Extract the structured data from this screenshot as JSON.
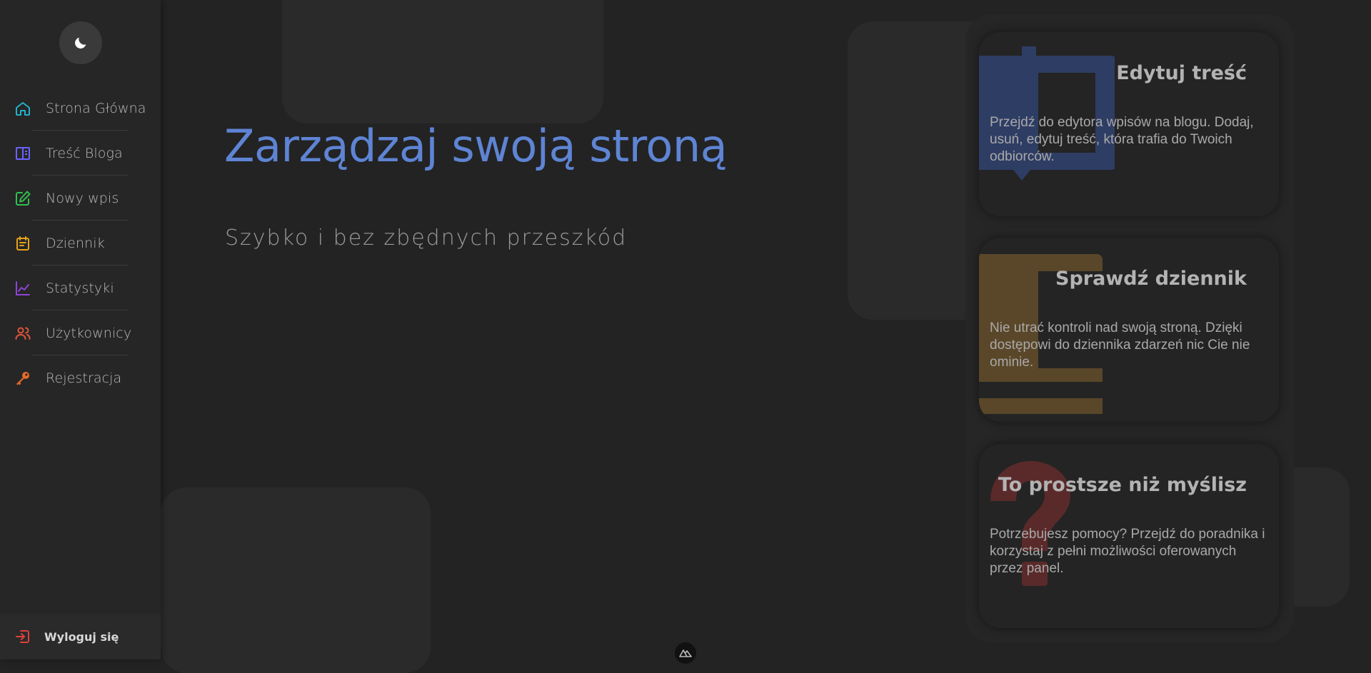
{
  "sidebar": {
    "theme_toggle_icon": "moon-icon",
    "items": [
      {
        "label": "Strona Główna",
        "icon": "home-icon",
        "color": "#22b0c8"
      },
      {
        "label": "Treść Bloga",
        "icon": "book-open-icon",
        "color": "#6c63ff"
      },
      {
        "label": "Nowy wpis",
        "icon": "edit-icon",
        "color": "#2fbf4f"
      },
      {
        "label": "Dziennik",
        "icon": "calendar-icon",
        "color": "#e6a21a"
      },
      {
        "label": "Statystyki",
        "icon": "chart-line-icon",
        "color": "#8e44d8"
      },
      {
        "label": "Użytkownicy",
        "icon": "users-icon",
        "color": "#e0553b"
      },
      {
        "label": "Rejestracja",
        "icon": "key-icon",
        "color": "#e46a2a"
      }
    ],
    "logout": {
      "label": "Wyloguj się",
      "icon": "logout-icon",
      "color": "#e0403b"
    }
  },
  "hero": {
    "title": "Zarządzaj swoją stroną",
    "subtitle": "Szybko i bez zbędnych przeszkód",
    "title_color": "#5e84d4"
  },
  "cards": [
    {
      "title": "Edytuj treść",
      "description": "Przejdź do edytora wpisów na blogu. Dodaj, usuń, edytuj treść, która trafia do Twoich odbiorców.",
      "icon": "book-bookmark-icon",
      "icon_color": "#2e3d64"
    },
    {
      "title": "Sprawdź dziennik",
      "description": "Nie utrać kontroli nad swoją stroną. Dzięki dostępowi do dziennika zdarzeń nic Cie nie ominie.",
      "icon": "journal-icon",
      "icon_color": "#5a4729"
    },
    {
      "title": "To prostsze niż myślisz",
      "description": "Potrzebujesz pomocy? Przejdź do poradnika i korzystaj z pełni możliwości oferowanych przez panel.",
      "icon": "question-mark-icon",
      "icon_color": "#5a2a2a"
    }
  ],
  "footer": {
    "logo_icon": "nuxt-logo-icon"
  }
}
